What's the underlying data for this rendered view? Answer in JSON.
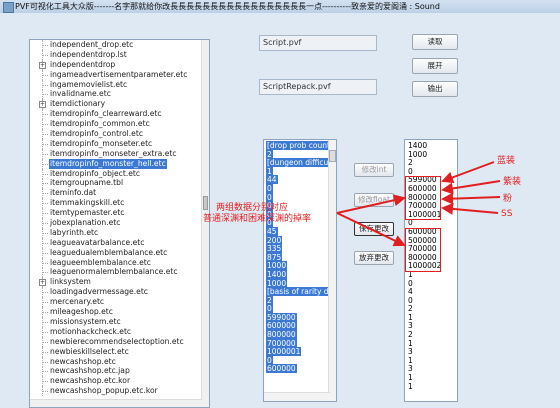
{
  "window": {
    "title": "PVF可视化工具大众版-------名字那就给你改長長長長長長長長長長長長長長長長長一点----------致亲爱的爱阁涌 : Sound"
  },
  "tree": {
    "items": [
      {
        "label": "independent_drop.etc",
        "expander": false,
        "selected": false
      },
      {
        "label": "independentdrop.lst",
        "expander": false,
        "selected": false
      },
      {
        "label": "independentdrop",
        "expander": true,
        "selected": false
      },
      {
        "label": "ingameadvertisementparameter.etc",
        "expander": false,
        "selected": false
      },
      {
        "label": "ingamemovielist.etc",
        "expander": false,
        "selected": false
      },
      {
        "label": "invalidname.etc",
        "expander": false,
        "selected": false
      },
      {
        "label": "itemdictionary",
        "expander": true,
        "selected": false
      },
      {
        "label": "itemdropinfo_clearreward.etc",
        "expander": false,
        "selected": false
      },
      {
        "label": "itemdropinfo_common.etc",
        "expander": false,
        "selected": false
      },
      {
        "label": "itemdropinfo_control.etc",
        "expander": false,
        "selected": false
      },
      {
        "label": "itemdropinfo_monseter.etc",
        "expander": false,
        "selected": false
      },
      {
        "label": "itemdropinfo_monseter_extra.etc",
        "expander": false,
        "selected": false
      },
      {
        "label": "itemdropinfo_monster_hell.etc",
        "expander": false,
        "selected": true
      },
      {
        "label": "itemdropinfo_object.etc",
        "expander": false,
        "selected": false
      },
      {
        "label": "itemgroupname.tbl",
        "expander": false,
        "selected": false
      },
      {
        "label": "iteminfo.dat",
        "expander": false,
        "selected": false
      },
      {
        "label": "itemmakingskill.etc",
        "expander": false,
        "selected": false
      },
      {
        "label": "itemtypemaster.etc",
        "expander": false,
        "selected": false
      },
      {
        "label": "jobexplanation.etc",
        "expander": false,
        "selected": false
      },
      {
        "label": "labyrinth.etc",
        "expander": false,
        "selected": false
      },
      {
        "label": "leagueavatarbalance.etc",
        "expander": false,
        "selected": false
      },
      {
        "label": "leaguedualemblembalance.etc",
        "expander": false,
        "selected": false
      },
      {
        "label": "leagueemblembalance.etc",
        "expander": false,
        "selected": false
      },
      {
        "label": "leaguenormalemblembalance.etc",
        "expander": false,
        "selected": false
      },
      {
        "label": "linksystem",
        "expander": true,
        "selected": false
      },
      {
        "label": "loadingadvermessage.etc",
        "expander": false,
        "selected": false
      },
      {
        "label": "mercenary.etc",
        "expander": false,
        "selected": false
      },
      {
        "label": "mileageshop.etc",
        "expander": false,
        "selected": false
      },
      {
        "label": "missionsystem.etc",
        "expander": false,
        "selected": false
      },
      {
        "label": "motionhackcheck.etc",
        "expander": false,
        "selected": false
      },
      {
        "label": "newbierecommendselectoption.etc",
        "expander": false,
        "selected": false
      },
      {
        "label": "newbieskillselect.etc",
        "expander": false,
        "selected": false
      },
      {
        "label": "newcashshop.etc",
        "expander": false,
        "selected": false
      },
      {
        "label": "newcashshop.etc.jap",
        "expander": false,
        "selected": false
      },
      {
        "label": "newcashshop.etc.kor",
        "expander": false,
        "selected": false
      },
      {
        "label": "newcashshop_popup.etc.kor",
        "expander": false,
        "selected": false
      }
    ]
  },
  "fields": {
    "script_pvf": "Script.pvf",
    "script_repack": "ScriptRepack.pvf"
  },
  "buttons": {
    "read": "读取",
    "unpack": "展开",
    "export": "输出",
    "modify_int": "修改int",
    "modify_float": "修改float",
    "save_changes": "保存更改",
    "discard_changes": "放弃更改"
  },
  "middle_list": {
    "items": [
      "[drop prob count",
      "2",
      "[dungeon difficult",
      "1",
      "44",
      "0",
      "0",
      "0",
      "0",
      "0",
      "45",
      "200",
      "335",
      "875",
      "1000",
      "1400",
      "1000",
      "[basis of rarity dic",
      "2",
      "0",
      "599000",
      "600000",
      "800000",
      "700000",
      "1000001",
      "0",
      "600000"
    ]
  },
  "right_list": {
    "items": [
      "1400",
      "1000",
      "2",
      "0",
      "599000",
      "600000",
      "800000",
      "700000",
      "1000001",
      "0",
      "600000",
      "500000",
      "700000",
      "800000",
      "1000002",
      "1",
      "0",
      "4",
      "0",
      "2",
      "1",
      "3",
      "2",
      "1",
      "3",
      "1",
      "3",
      "1",
      "1"
    ]
  },
  "annotations": {
    "blue": "蓝装",
    "purple": "紫装",
    "pink": "粉",
    "ss": "SS",
    "note_line1": "两组数据分别对应",
    "note_line2": "普通深渊和困难深渊的掉率"
  },
  "colors": {
    "annotation_red": "#e02020",
    "selection_blue": "#3b79d4"
  }
}
